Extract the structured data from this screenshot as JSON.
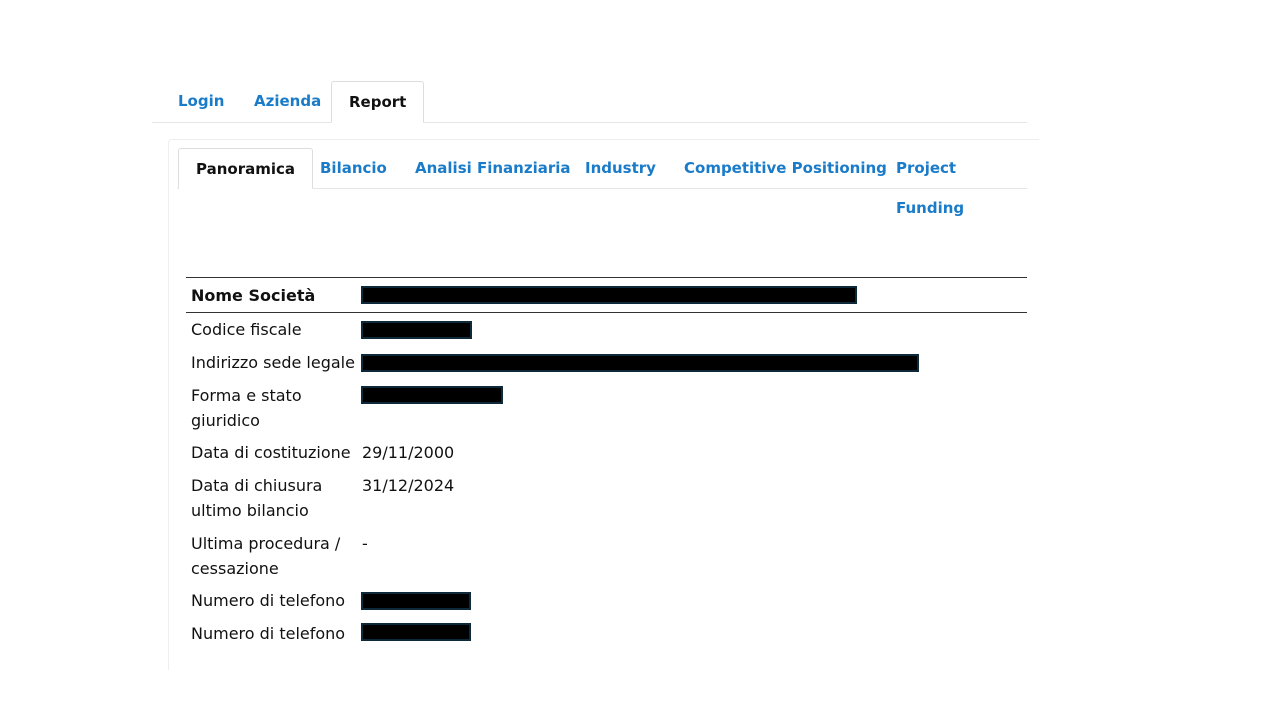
{
  "top_tabs": [
    {
      "label": "Login"
    },
    {
      "label": "Azienda"
    },
    {
      "label": "Report",
      "active": true
    }
  ],
  "sub_tabs": [
    {
      "label": "Panoramica",
      "active": true
    },
    {
      "label": "Bilancio"
    },
    {
      "label": "Analisi Finanziaria"
    },
    {
      "label": "Industry"
    },
    {
      "label": "Competitive Positioning"
    },
    {
      "label": "Project Funding"
    }
  ],
  "colors": {
    "link": "#1a7bc9",
    "redaction": "#000000"
  },
  "company": {
    "header_label": "Nome Società",
    "rows": [
      {
        "label": "Codice fiscale"
      },
      {
        "label": "Indirizzo sede legale"
      },
      {
        "label": "Forma e stato giuridico"
      },
      {
        "label": "Data di costituzione",
        "value": "29/11/2000"
      },
      {
        "label": "Data di chiusura ultimo bilancio",
        "value": "31/12/2024"
      },
      {
        "label": "Ultima procedura / cessazione",
        "value": "-"
      },
      {
        "label": "Numero di telefono"
      },
      {
        "label": "Numero di telefono"
      }
    ]
  }
}
